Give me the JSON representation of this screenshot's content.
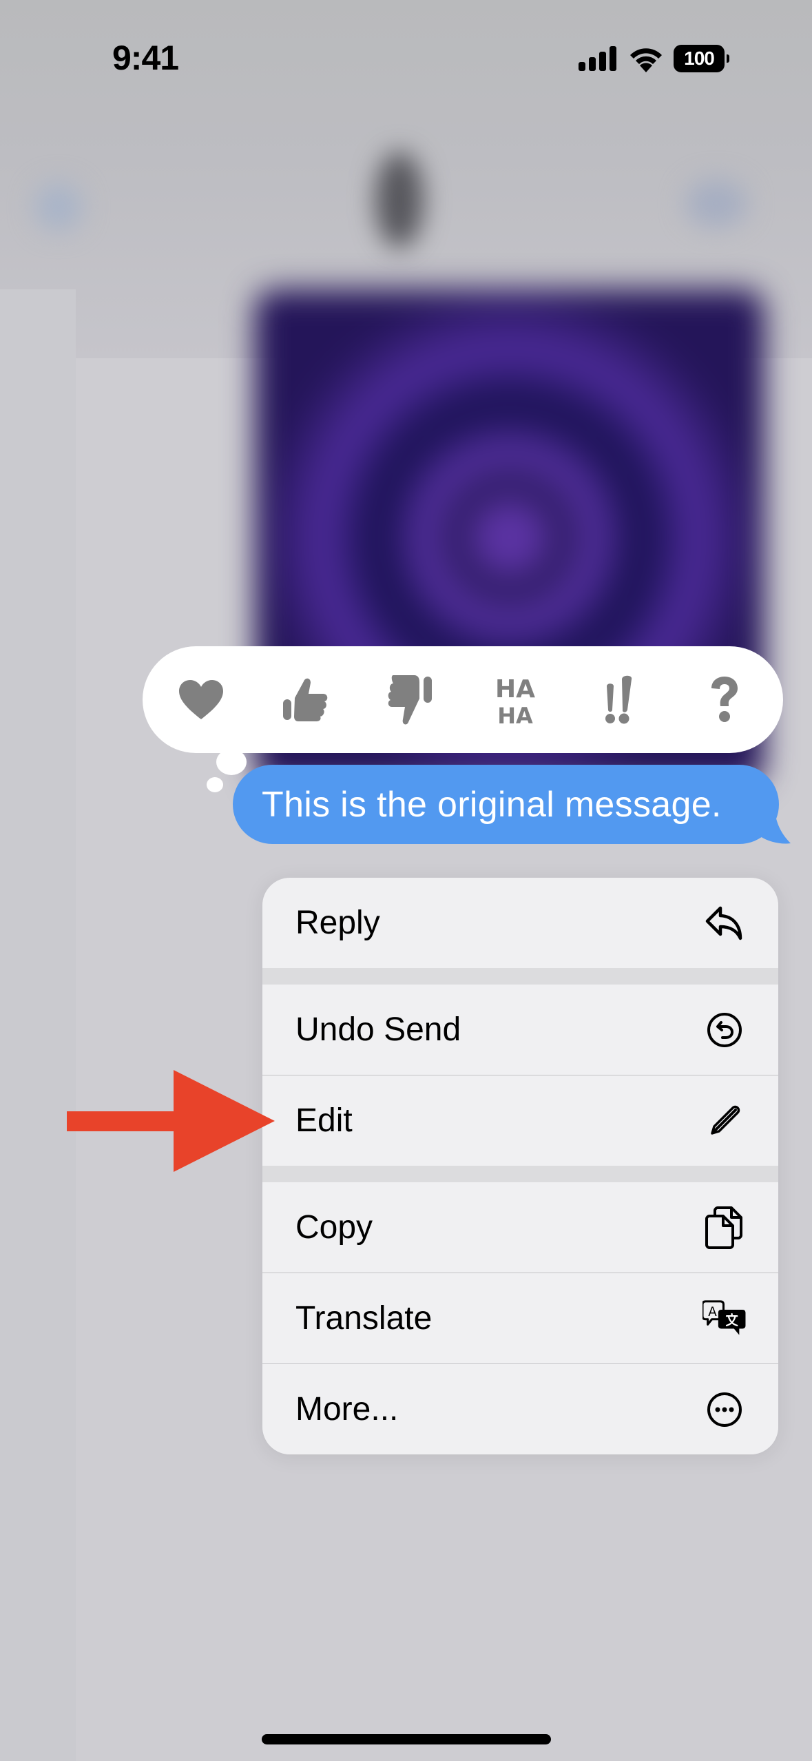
{
  "status_bar": {
    "time": "9:41",
    "battery_level": "100",
    "icons": [
      "cellular-signal-icon",
      "wifi-icon",
      "battery-icon"
    ]
  },
  "background": {
    "description": "blurred Messages conversation",
    "nav_icons": [
      "back-icon",
      "video-call-icon"
    ],
    "has_avatar": true,
    "has_image_attachment": true
  },
  "reactions": [
    {
      "name": "heart",
      "icon": "heart-icon"
    },
    {
      "name": "thumbs-up",
      "icon": "thumbs-up-icon"
    },
    {
      "name": "thumbs-down",
      "icon": "thumbs-down-icon"
    },
    {
      "name": "haha",
      "icon": "haha-icon",
      "text_top": "HA",
      "text_bottom": "HA"
    },
    {
      "name": "emphasize",
      "icon": "double-exclamation-icon",
      "text": "!!"
    },
    {
      "name": "question",
      "icon": "question-mark-icon",
      "text": "?"
    }
  ],
  "message": {
    "text": "This is the original message.",
    "bubble_color": "#5299F0"
  },
  "menu": {
    "items": [
      {
        "label": "Reply",
        "icon": "reply-arrow-icon",
        "group": 1
      },
      {
        "label": "Undo Send",
        "icon": "undo-circle-icon",
        "group": 2
      },
      {
        "label": "Edit",
        "icon": "pencil-icon",
        "group": 2,
        "highlighted_by_annotation": true
      },
      {
        "label": "Copy",
        "icon": "copy-documents-icon",
        "group": 3
      },
      {
        "label": "Translate",
        "icon": "translate-bubbles-icon",
        "group": 3
      },
      {
        "label": "More...",
        "icon": "ellipsis-circle-icon",
        "group": 3
      }
    ]
  },
  "annotation": {
    "type": "arrow",
    "points_to": "Edit",
    "color": "#E8432A"
  },
  "colors": {
    "reaction_icon": "#808080",
    "menu_background": "#F0F0F2",
    "menu_separator_gap": "#DCDCDE",
    "screen_background": "#CECDD2"
  }
}
